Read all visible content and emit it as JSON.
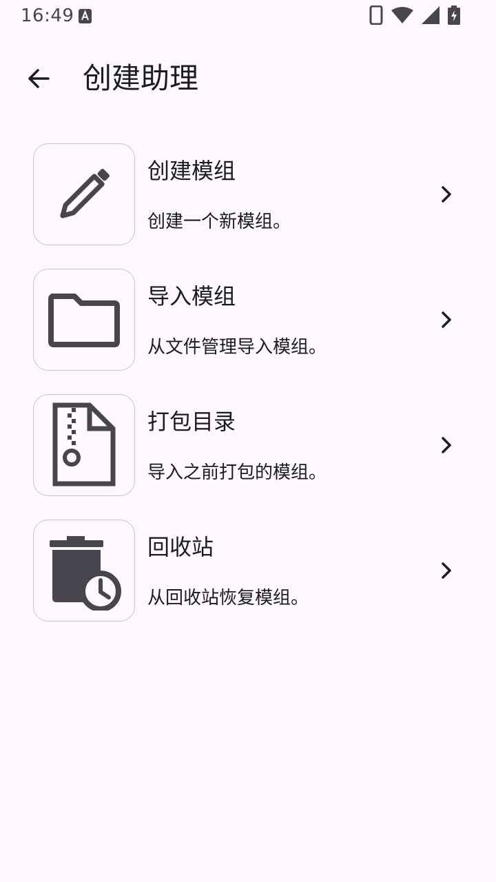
{
  "status_bar": {
    "time": "16:49",
    "icons": [
      "accessibility-a-icon",
      "phone-icon",
      "wifi-icon",
      "signal-icon",
      "battery-charging-icon"
    ]
  },
  "app_bar": {
    "back_icon": "arrow-back-icon",
    "title": "创建助理"
  },
  "options": [
    {
      "title": "创建模组",
      "description": "创建一个新模组。",
      "icon": "pencil-icon"
    },
    {
      "title": "导入模组",
      "description": "从文件管理导入模组。",
      "icon": "folder-icon"
    },
    {
      "title": "打包目录",
      "description": "导入之前打包的模组。",
      "icon": "zip-file-icon"
    },
    {
      "title": "回收站",
      "description": "从回收站恢复模组。",
      "icon": "trash-clock-icon"
    }
  ],
  "colors": {
    "background": "#fcf8fd",
    "icon": "#49454f",
    "border": "#c9c5ca",
    "text": "#1c1b1f"
  }
}
